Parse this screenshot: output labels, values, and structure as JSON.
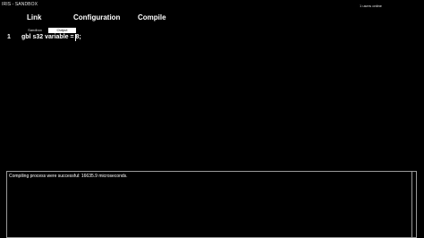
{
  "window": {
    "title": "IRIS - SANDBOX"
  },
  "status": {
    "users_online": "1 users online"
  },
  "nav": {
    "link": "Link",
    "configuration": "Configuration",
    "compile": "Compile"
  },
  "tabs": {
    "sandbox": "Sandbox",
    "output": "Output"
  },
  "editor": {
    "line_number": "1",
    "code": "gbl s32 variable = 8;"
  },
  "console": {
    "message": "Compiling process were successful: 16635.9 microseconds."
  }
}
